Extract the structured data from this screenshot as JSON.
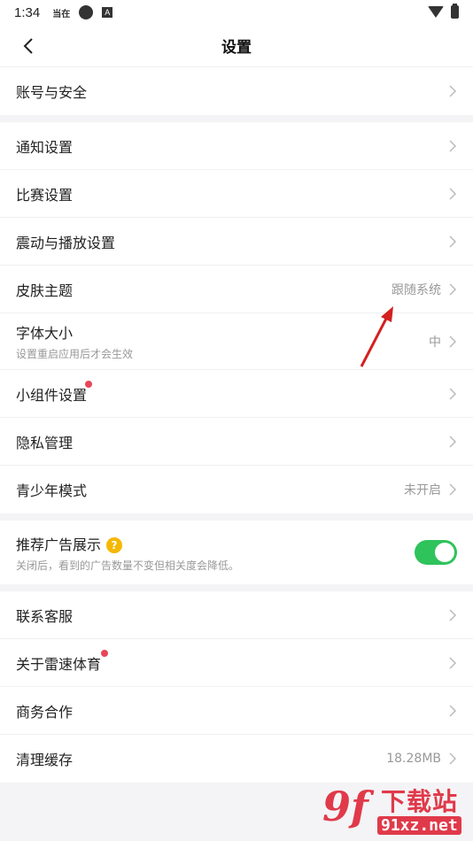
{
  "status_bar": {
    "time": "1:34",
    "icons": [
      "app-badge-icon",
      "pinwheel-icon",
      "a-box-icon"
    ],
    "app_badge_text": "当在",
    "a_box_text": "A"
  },
  "header": {
    "back_icon": "chevron-left-icon",
    "title": "设置"
  },
  "groups": {
    "account": {
      "label": "账号与安全"
    },
    "general": {
      "notification": {
        "label": "通知设置"
      },
      "match": {
        "label": "比赛设置"
      },
      "vibration": {
        "label": "震动与播放设置"
      },
      "skin": {
        "label": "皮肤主题",
        "value": "跟随系统"
      },
      "font": {
        "label": "字体大小",
        "sublabel": "设置重启应用后才会生效",
        "value": "中"
      },
      "widget": {
        "label": "小组件设置"
      },
      "privacy": {
        "label": "隐私管理"
      },
      "youth": {
        "label": "青少年模式",
        "value": "未开启"
      }
    },
    "ads": {
      "label": "推荐广告展示",
      "help_icon": "?",
      "sublabel": "关闭后，看到的广告数量不变但相关度会降低。",
      "enabled": true
    },
    "other": {
      "service": {
        "label": "联系客服"
      },
      "about": {
        "label": "关于雷速体育"
      },
      "business": {
        "label": "商务合作"
      },
      "cache": {
        "label": "清理缓存",
        "value": "18.28MB"
      }
    }
  },
  "colors": {
    "toggle_on": "#2fc35c",
    "red_dot": "#e8455a",
    "help_icon": "#f5b800",
    "annotation_arrow": "#d42020",
    "watermark": "#e03a4a"
  },
  "watermark": {
    "logo": "9f",
    "title": "下载站",
    "url": "91xz.net"
  }
}
